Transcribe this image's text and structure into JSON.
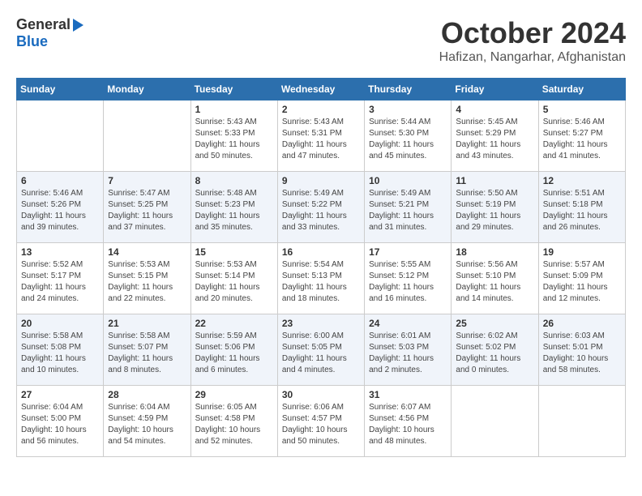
{
  "header": {
    "logo_general": "General",
    "logo_blue": "Blue",
    "month_year": "October 2024",
    "location": "Hafizan, Nangarhar, Afghanistan"
  },
  "calendar": {
    "days_of_week": [
      "Sunday",
      "Monday",
      "Tuesday",
      "Wednesday",
      "Thursday",
      "Friday",
      "Saturday"
    ],
    "weeks": [
      [
        {
          "day": "",
          "details": ""
        },
        {
          "day": "",
          "details": ""
        },
        {
          "day": "1",
          "details": "Sunrise: 5:43 AM\nSunset: 5:33 PM\nDaylight: 11 hours and 50 minutes."
        },
        {
          "day": "2",
          "details": "Sunrise: 5:43 AM\nSunset: 5:31 PM\nDaylight: 11 hours and 47 minutes."
        },
        {
          "day": "3",
          "details": "Sunrise: 5:44 AM\nSunset: 5:30 PM\nDaylight: 11 hours and 45 minutes."
        },
        {
          "day": "4",
          "details": "Sunrise: 5:45 AM\nSunset: 5:29 PM\nDaylight: 11 hours and 43 minutes."
        },
        {
          "day": "5",
          "details": "Sunrise: 5:46 AM\nSunset: 5:27 PM\nDaylight: 11 hours and 41 minutes."
        }
      ],
      [
        {
          "day": "6",
          "details": "Sunrise: 5:46 AM\nSunset: 5:26 PM\nDaylight: 11 hours and 39 minutes."
        },
        {
          "day": "7",
          "details": "Sunrise: 5:47 AM\nSunset: 5:25 PM\nDaylight: 11 hours and 37 minutes."
        },
        {
          "day": "8",
          "details": "Sunrise: 5:48 AM\nSunset: 5:23 PM\nDaylight: 11 hours and 35 minutes."
        },
        {
          "day": "9",
          "details": "Sunrise: 5:49 AM\nSunset: 5:22 PM\nDaylight: 11 hours and 33 minutes."
        },
        {
          "day": "10",
          "details": "Sunrise: 5:49 AM\nSunset: 5:21 PM\nDaylight: 11 hours and 31 minutes."
        },
        {
          "day": "11",
          "details": "Sunrise: 5:50 AM\nSunset: 5:19 PM\nDaylight: 11 hours and 29 minutes."
        },
        {
          "day": "12",
          "details": "Sunrise: 5:51 AM\nSunset: 5:18 PM\nDaylight: 11 hours and 26 minutes."
        }
      ],
      [
        {
          "day": "13",
          "details": "Sunrise: 5:52 AM\nSunset: 5:17 PM\nDaylight: 11 hours and 24 minutes."
        },
        {
          "day": "14",
          "details": "Sunrise: 5:53 AM\nSunset: 5:15 PM\nDaylight: 11 hours and 22 minutes."
        },
        {
          "day": "15",
          "details": "Sunrise: 5:53 AM\nSunset: 5:14 PM\nDaylight: 11 hours and 20 minutes."
        },
        {
          "day": "16",
          "details": "Sunrise: 5:54 AM\nSunset: 5:13 PM\nDaylight: 11 hours and 18 minutes."
        },
        {
          "day": "17",
          "details": "Sunrise: 5:55 AM\nSunset: 5:12 PM\nDaylight: 11 hours and 16 minutes."
        },
        {
          "day": "18",
          "details": "Sunrise: 5:56 AM\nSunset: 5:10 PM\nDaylight: 11 hours and 14 minutes."
        },
        {
          "day": "19",
          "details": "Sunrise: 5:57 AM\nSunset: 5:09 PM\nDaylight: 11 hours and 12 minutes."
        }
      ],
      [
        {
          "day": "20",
          "details": "Sunrise: 5:58 AM\nSunset: 5:08 PM\nDaylight: 11 hours and 10 minutes."
        },
        {
          "day": "21",
          "details": "Sunrise: 5:58 AM\nSunset: 5:07 PM\nDaylight: 11 hours and 8 minutes."
        },
        {
          "day": "22",
          "details": "Sunrise: 5:59 AM\nSunset: 5:06 PM\nDaylight: 11 hours and 6 minutes."
        },
        {
          "day": "23",
          "details": "Sunrise: 6:00 AM\nSunset: 5:05 PM\nDaylight: 11 hours and 4 minutes."
        },
        {
          "day": "24",
          "details": "Sunrise: 6:01 AM\nSunset: 5:03 PM\nDaylight: 11 hours and 2 minutes."
        },
        {
          "day": "25",
          "details": "Sunrise: 6:02 AM\nSunset: 5:02 PM\nDaylight: 11 hours and 0 minutes."
        },
        {
          "day": "26",
          "details": "Sunrise: 6:03 AM\nSunset: 5:01 PM\nDaylight: 10 hours and 58 minutes."
        }
      ],
      [
        {
          "day": "27",
          "details": "Sunrise: 6:04 AM\nSunset: 5:00 PM\nDaylight: 10 hours and 56 minutes."
        },
        {
          "day": "28",
          "details": "Sunrise: 6:04 AM\nSunset: 4:59 PM\nDaylight: 10 hours and 54 minutes."
        },
        {
          "day": "29",
          "details": "Sunrise: 6:05 AM\nSunset: 4:58 PM\nDaylight: 10 hours and 52 minutes."
        },
        {
          "day": "30",
          "details": "Sunrise: 6:06 AM\nSunset: 4:57 PM\nDaylight: 10 hours and 50 minutes."
        },
        {
          "day": "31",
          "details": "Sunrise: 6:07 AM\nSunset: 4:56 PM\nDaylight: 10 hours and 48 minutes."
        },
        {
          "day": "",
          "details": ""
        },
        {
          "day": "",
          "details": ""
        }
      ]
    ]
  }
}
